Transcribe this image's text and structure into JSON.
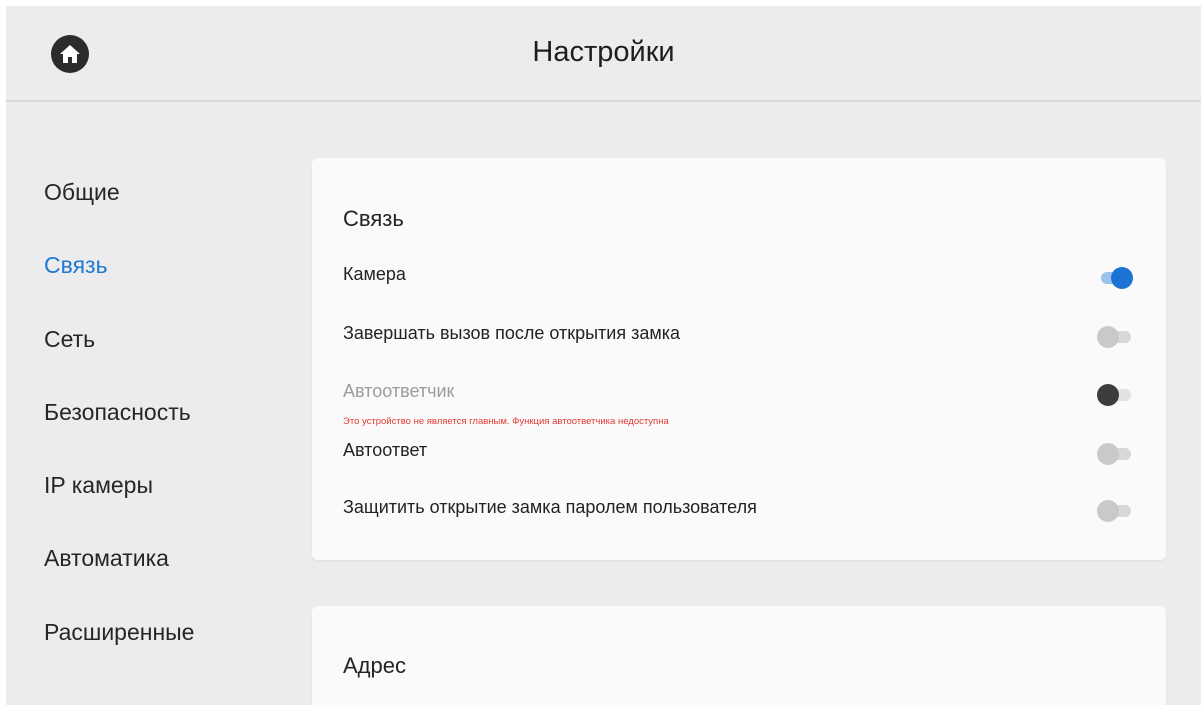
{
  "header": {
    "title": "Настройки",
    "home_icon": "home-icon"
  },
  "sidebar": {
    "items": [
      {
        "label": "Общие",
        "active": false
      },
      {
        "label": "Связь",
        "active": true
      },
      {
        "label": "Сеть",
        "active": false
      },
      {
        "label": "Безопасность",
        "active": false
      },
      {
        "label": "IP камеры",
        "active": false
      },
      {
        "label": "Автоматика",
        "active": false
      },
      {
        "label": "Расширенные",
        "active": false
      }
    ]
  },
  "connection": {
    "title": "Связь",
    "rows": [
      {
        "label": "Камера",
        "state": "on",
        "disabled": false
      },
      {
        "label": "Завершать вызов после открытия замка",
        "state": "off",
        "disabled": false
      },
      {
        "label": "Автоответчик",
        "state": "off",
        "disabled": true
      },
      {
        "label": "Автоответ",
        "state": "off",
        "disabled": false
      },
      {
        "label": "Защитить открытие замка паролем пользователя",
        "state": "off",
        "disabled": false
      }
    ],
    "warning": "Это устройство не является главным. Функция автоответчика недоступна"
  },
  "address": {
    "title": "Адрес"
  },
  "colors": {
    "accent": "#1f78d1",
    "warning": "#e53935",
    "background": "#ececee",
    "card": "#fafafa"
  }
}
